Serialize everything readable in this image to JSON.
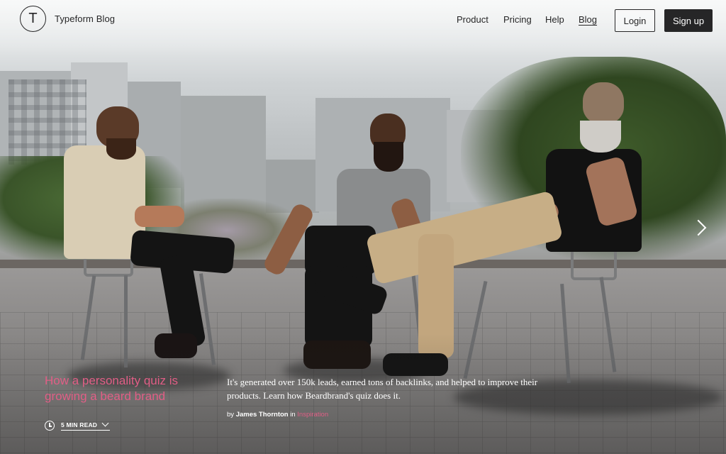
{
  "header": {
    "logo_letter": "T",
    "brand": "Typeform Blog",
    "nav": [
      {
        "label": "Product",
        "active": false
      },
      {
        "label": "Pricing",
        "active": false
      },
      {
        "label": "Help",
        "active": false
      },
      {
        "label": "Blog",
        "active": true
      }
    ],
    "login_label": "Login",
    "signup_label": "Sign up"
  },
  "hero": {
    "icon_next": "chevron-right-icon"
  },
  "article": {
    "title": "How a personality quiz is growing a beard brand",
    "excerpt": "It's generated over 150k leads, earned tons of backlinks, and helped to improve their products. Learn how Beardbrand's quiz does it.",
    "by": "by",
    "author": "James Thornton",
    "in": "in",
    "category": "Inspiration",
    "read_time": "5 MIN READ",
    "icons": {
      "clock": "clock-icon",
      "expand": "chevron-down-icon"
    }
  },
  "colors": {
    "accent": "#e15e86",
    "dark": "#262627",
    "white": "#ffffff"
  }
}
